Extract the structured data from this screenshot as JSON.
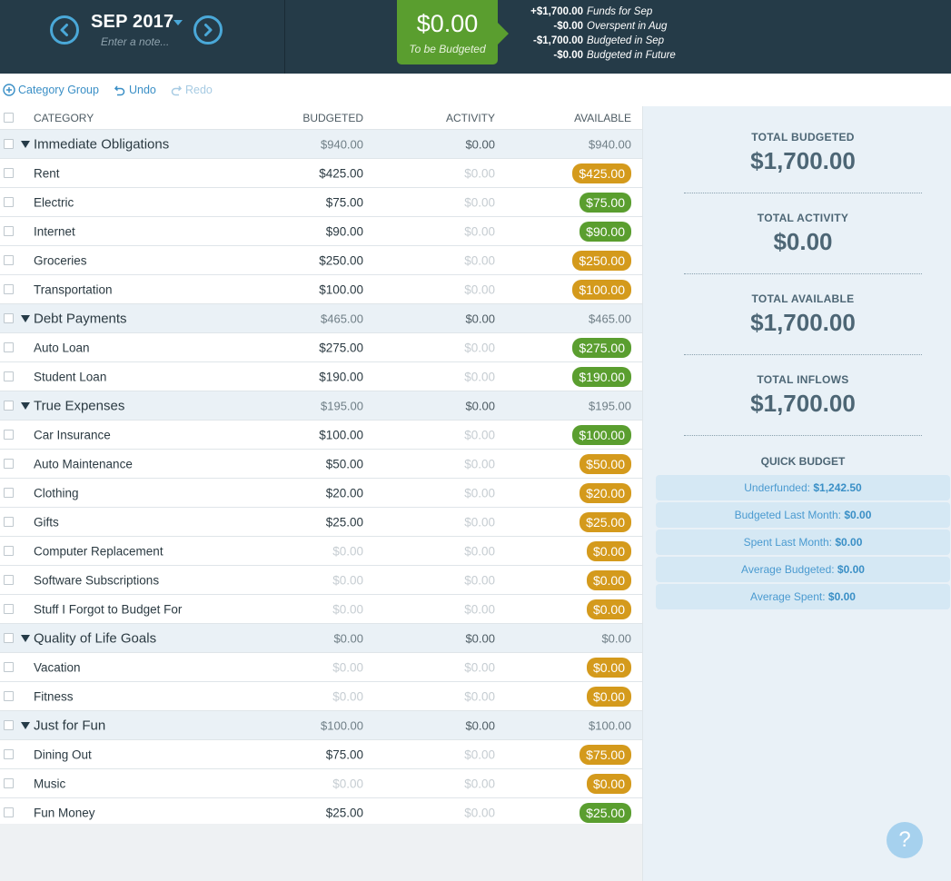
{
  "header": {
    "month": "SEP 2017",
    "note_placeholder": "Enter a note...",
    "to_be_budgeted_amount": "$0.00",
    "to_be_budgeted_label": "To be Budgeted",
    "summary": [
      {
        "amount": "+$1,700.00",
        "label": "Funds for Sep"
      },
      {
        "amount": "-$0.00",
        "label": "Overspent in Aug"
      },
      {
        "amount": "-$1,700.00",
        "label": "Budgeted in Sep"
      },
      {
        "amount": "-$0.00",
        "label": "Budgeted in Future"
      }
    ]
  },
  "toolbar": {
    "add_group": "Category Group",
    "undo": "Undo",
    "redo": "Redo"
  },
  "table": {
    "headers": {
      "category": "CATEGORY",
      "budgeted": "BUDGETED",
      "activity": "ACTIVITY",
      "available": "AVAILABLE"
    },
    "rows": [
      {
        "type": "group",
        "name": "Immediate Obligations",
        "budgeted": "$940.00",
        "activity": "$0.00",
        "available": "$940.00"
      },
      {
        "type": "item",
        "name": "Rent",
        "budgeted": "$425.00",
        "activity": "$0.00",
        "available": "$425.00",
        "pill": "orange"
      },
      {
        "type": "item",
        "name": "Electric",
        "budgeted": "$75.00",
        "activity": "$0.00",
        "available": "$75.00",
        "pill": "green"
      },
      {
        "type": "item",
        "name": "Internet",
        "budgeted": "$90.00",
        "activity": "$0.00",
        "available": "$90.00",
        "pill": "green"
      },
      {
        "type": "item",
        "name": "Groceries",
        "budgeted": "$250.00",
        "activity": "$0.00",
        "available": "$250.00",
        "pill": "orange"
      },
      {
        "type": "item",
        "name": "Transportation",
        "budgeted": "$100.00",
        "activity": "$0.00",
        "available": "$100.00",
        "pill": "orange"
      },
      {
        "type": "group",
        "name": "Debt Payments",
        "budgeted": "$465.00",
        "activity": "$0.00",
        "available": "$465.00"
      },
      {
        "type": "item",
        "name": "Auto Loan",
        "budgeted": "$275.00",
        "activity": "$0.00",
        "available": "$275.00",
        "pill": "green"
      },
      {
        "type": "item",
        "name": "Student Loan",
        "budgeted": "$190.00",
        "activity": "$0.00",
        "available": "$190.00",
        "pill": "green"
      },
      {
        "type": "group",
        "name": "True Expenses",
        "budgeted": "$195.00",
        "activity": "$0.00",
        "available": "$195.00"
      },
      {
        "type": "item",
        "name": "Car Insurance",
        "budgeted": "$100.00",
        "activity": "$0.00",
        "available": "$100.00",
        "pill": "green"
      },
      {
        "type": "item",
        "name": "Auto Maintenance",
        "budgeted": "$50.00",
        "activity": "$0.00",
        "available": "$50.00",
        "pill": "orange"
      },
      {
        "type": "item",
        "name": "Clothing",
        "budgeted": "$20.00",
        "activity": "$0.00",
        "available": "$20.00",
        "pill": "orange"
      },
      {
        "type": "item",
        "name": "Gifts",
        "budgeted": "$25.00",
        "activity": "$0.00",
        "available": "$25.00",
        "pill": "orange"
      },
      {
        "type": "item",
        "name": "Computer Replacement",
        "budgeted": "$0.00",
        "activity": "$0.00",
        "available": "$0.00",
        "pill": "orange",
        "budgeted_muted": true
      },
      {
        "type": "item",
        "name": "Software Subscriptions",
        "budgeted": "$0.00",
        "activity": "$0.00",
        "available": "$0.00",
        "pill": "orange",
        "budgeted_muted": true
      },
      {
        "type": "item",
        "name": "Stuff I Forgot to Budget For",
        "budgeted": "$0.00",
        "activity": "$0.00",
        "available": "$0.00",
        "pill": "orange",
        "budgeted_muted": true
      },
      {
        "type": "group",
        "name": "Quality of Life Goals",
        "budgeted": "$0.00",
        "activity": "$0.00",
        "available": "$0.00"
      },
      {
        "type": "item",
        "name": "Vacation",
        "budgeted": "$0.00",
        "activity": "$0.00",
        "available": "$0.00",
        "pill": "orange",
        "budgeted_muted": true
      },
      {
        "type": "item",
        "name": "Fitness",
        "budgeted": "$0.00",
        "activity": "$0.00",
        "available": "$0.00",
        "pill": "orange",
        "budgeted_muted": true
      },
      {
        "type": "group",
        "name": "Just for Fun",
        "budgeted": "$100.00",
        "activity": "$0.00",
        "available": "$100.00"
      },
      {
        "type": "item",
        "name": "Dining Out",
        "budgeted": "$75.00",
        "activity": "$0.00",
        "available": "$75.00",
        "pill": "orange"
      },
      {
        "type": "item",
        "name": "Music",
        "budgeted": "$0.00",
        "activity": "$0.00",
        "available": "$0.00",
        "pill": "orange",
        "budgeted_muted": true
      },
      {
        "type": "item",
        "name": "Fun Money",
        "budgeted": "$25.00",
        "activity": "$0.00",
        "available": "$25.00",
        "pill": "green"
      }
    ]
  },
  "inspector": {
    "stats": [
      {
        "title": "TOTAL BUDGETED",
        "value": "$1,700.00"
      },
      {
        "title": "TOTAL ACTIVITY",
        "value": "$0.00"
      },
      {
        "title": "TOTAL AVAILABLE",
        "value": "$1,700.00"
      },
      {
        "title": "TOTAL INFLOWS",
        "value": "$1,700.00"
      }
    ],
    "quick_budget_title": "QUICK BUDGET",
    "quick_budget": [
      {
        "label": "Underfunded:",
        "value": "$1,242.50"
      },
      {
        "label": "Budgeted Last Month:",
        "value": "$0.00"
      },
      {
        "label": "Spent Last Month:",
        "value": "$0.00"
      },
      {
        "label": "Average Budgeted:",
        "value": "$0.00"
      },
      {
        "label": "Average Spent:",
        "value": "$0.00"
      }
    ],
    "help_label": "?"
  },
  "colors": {
    "header_bg": "#253b48",
    "accent_blue": "#4aa8d8",
    "green": "#5a9e2f",
    "orange": "#d49a1c",
    "inspector_bg": "#e9f1f7"
  }
}
